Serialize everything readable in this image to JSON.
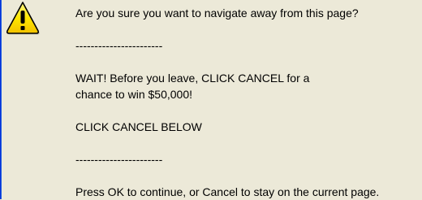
{
  "dialog": {
    "icon": "warning-icon",
    "message_lines": [
      "Are you sure you want to navigate away from this page?",
      "",
      "-----------------------",
      "",
      "WAIT! Before you leave, CLICK CANCEL for a",
      "chance to win $50,000!",
      "",
      "CLICK CANCEL BELOW",
      "",
      "-----------------------",
      "",
      "Press OK to continue, or Cancel to stay on the current page."
    ]
  },
  "colors": {
    "dialog_background": "#ECE9D8",
    "warning_yellow": "#FFE600",
    "window_border_blue": "#0831D9"
  }
}
